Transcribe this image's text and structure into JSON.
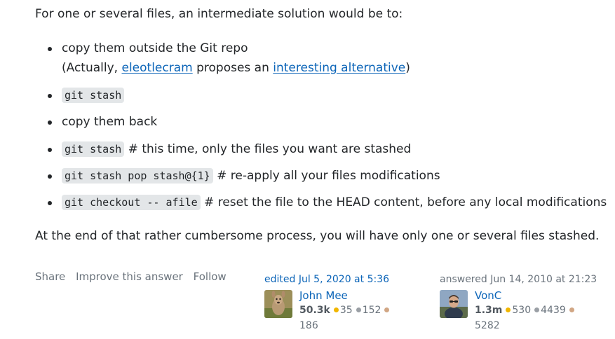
{
  "post": {
    "intro": "For one or several files, an intermediate solution would be to:",
    "steps": [
      {
        "text": "copy them outside the Git repo"
      },
      {
        "sub_prefix": "(Actually, ",
        "link1": "eleotlecram",
        "sub_mid": " proposes an ",
        "link2": "interesting alternative",
        "sub_suffix": ")"
      },
      {
        "code": "git stash"
      },
      {
        "text": "copy them back"
      },
      {
        "code": "git stash",
        "comment": " # this time, only the files you want are stashed"
      },
      {
        "code": "git stash pop stash@{1}",
        "comment": " # re-apply all your files modifications"
      },
      {
        "code": "git checkout -- afile",
        "comment": " # reset the file to the HEAD content, before any local modifications"
      }
    ],
    "outro": "At the end of that rather cumbersome process, you will have only one or several files stashed."
  },
  "actions": {
    "share": "Share",
    "improve": "Improve this answer",
    "follow": "Follow"
  },
  "editor": {
    "action_time": "edited Jul 5, 2020 at 5:36",
    "name": "John Mee",
    "rep": "50.3k",
    "gold": "35",
    "silver": "152",
    "bronze": "186"
  },
  "owner": {
    "action_time": "answered Jun 14, 2010 at 21:23",
    "name": "VonC",
    "rep": "1.3m",
    "gold": "530",
    "silver": "4439",
    "bronze": "5282"
  },
  "colors": {
    "link": "#0c65b8",
    "gold": "#f1b600",
    "silver": "#9a9fa5",
    "bronze": "#d1a684"
  }
}
